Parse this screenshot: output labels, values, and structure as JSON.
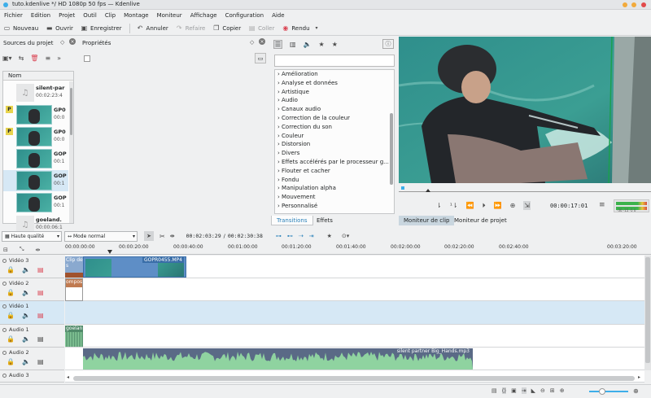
{
  "window": {
    "title": "tuto.kdenlive */ HD 1080p 50 fps — Kdenlive"
  },
  "menu": [
    "Fichier",
    "Edition",
    "Projet",
    "Outil",
    "Clip",
    "Montage",
    "Moniteur",
    "Affichage",
    "Configuration",
    "Aide"
  ],
  "toolbar": {
    "new": "Nouveau",
    "open": "Ouvrir",
    "save": "Enregistrer",
    "undo": "Annuler",
    "redo": "Refaire",
    "copy": "Copier",
    "paste": "Coller",
    "render": "Rendu"
  },
  "project_bin": {
    "title": "Sources du projet",
    "column": "Nom",
    "clips": [
      {
        "name": "silent-par",
        "meta": "00:02:23:4",
        "kind": "audio"
      },
      {
        "name": "GP0",
        "meta": "00:0",
        "kind": "video",
        "badge": "P"
      },
      {
        "name": "GP0",
        "meta": "00:0",
        "kind": "video",
        "badge": "P"
      },
      {
        "name": "GOP",
        "meta": "00:1",
        "kind": "video"
      },
      {
        "name": "GOP",
        "meta": "00:1",
        "kind": "video"
      },
      {
        "name": "GOP",
        "meta": "00:1",
        "kind": "video"
      },
      {
        "name": "goeland.",
        "meta": "00:00:06:1",
        "kind": "audio"
      }
    ]
  },
  "properties": {
    "title": "Propriétés"
  },
  "effects": {
    "items": [
      "Amélioration",
      "Analyse et données",
      "Artistique",
      "Audio",
      "Canaux audio",
      "Correction de la couleur",
      "Correction du son",
      "Couleur",
      "Distorsion",
      "Divers",
      "Effets accélérés par le processeur g...",
      "Flouter et cacher",
      "Fondu",
      "Manipulation alpha",
      "Mouvement",
      "Personnalisé"
    ],
    "tabs": [
      "Transitions",
      "Effets"
    ]
  },
  "monitor": {
    "timecode": "00:00:17:01",
    "tabs": [
      "Moniteur de clip",
      "Moniteur de projet"
    ],
    "meter_labels": "-30 -15 -5 0"
  },
  "timeline_toolbar": {
    "quality": "Haute qualité",
    "mode": "Mode normal",
    "position": "00:02:03:29",
    "duration": "00:02:30:38"
  },
  "ruler": [
    "00:00:00:00",
    "00:00:20:00",
    "00:00:40:00",
    "00:01:00:00",
    "00:01:20:00",
    "00:01:40:00",
    "00:02:00:00",
    "00:02:20:00",
    "00:02:40:00",
    "00:03:20:00"
  ],
  "tracks": [
    {
      "name": "Vidéo 3",
      "type": "video"
    },
    {
      "name": "Vidéo 2",
      "type": "video"
    },
    {
      "name": "Vidéo 1",
      "type": "video",
      "active": true
    },
    {
      "name": "Audio 1",
      "type": "audio"
    },
    {
      "name": "Audio 2",
      "type": "audio"
    },
    {
      "name": "Audio 3",
      "type": "audio"
    }
  ],
  "timeline_clips": {
    "v3_clip": "GOPR0455.MP4",
    "v3_short": "Clip de",
    "v3_short2": "s",
    "v2_label": "ompos",
    "a1_clip": "goelan",
    "a2_clip": "silent partner Big_Hands.mp3"
  },
  "colors": {
    "accent": "#3daee9",
    "video_clip": "#5e8ec6",
    "audio_clip": "#4f8a69",
    "selection": "#d6e8f5"
  }
}
